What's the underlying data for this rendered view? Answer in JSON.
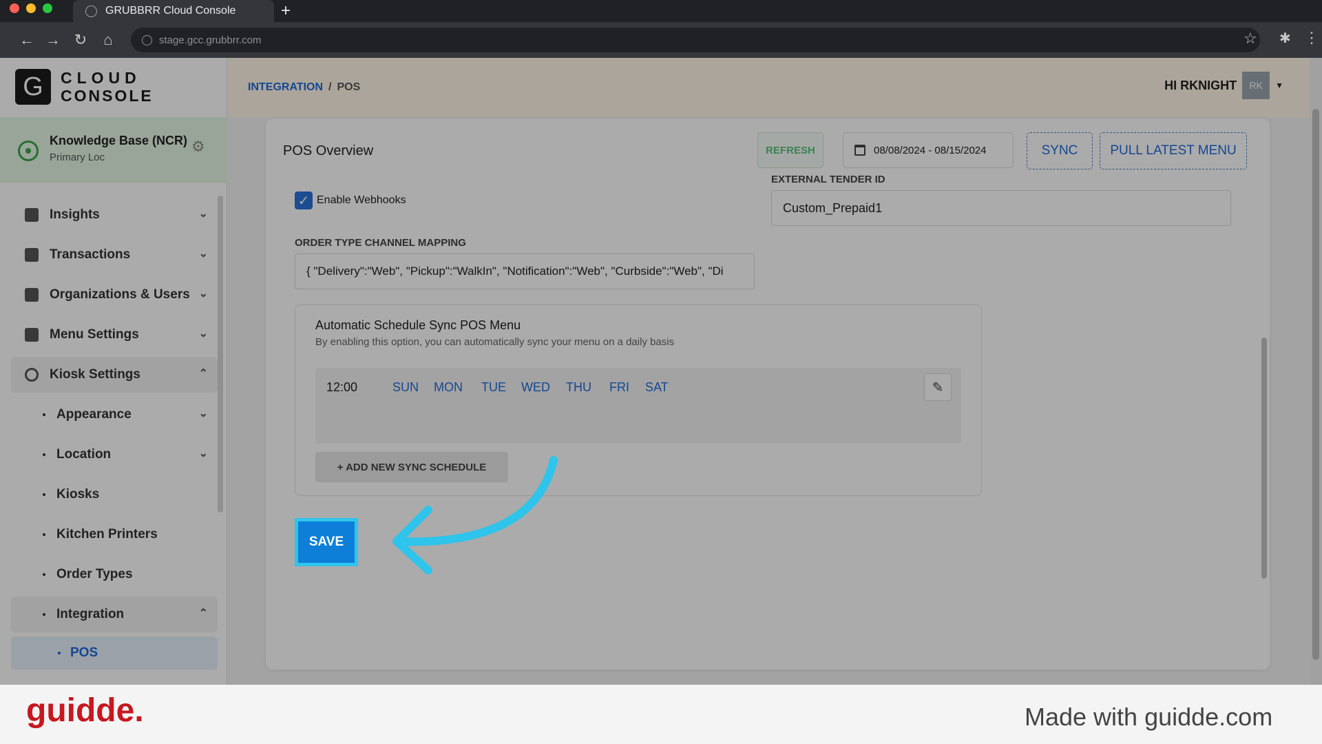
{
  "browser": {
    "tab_title": "GRUBBRR Cloud Console",
    "url": "stage.gcc.grubbrr.com"
  },
  "logo": {
    "mark": "G",
    "line1": "CLOUD",
    "line2": "CONSOLE"
  },
  "location": {
    "name": "Knowledge Base (NCR)",
    "sub": "Primary Loc"
  },
  "sidebar": {
    "items": [
      {
        "label": "Insights"
      },
      {
        "label": "Transactions"
      },
      {
        "label": "Organizations & Users"
      },
      {
        "label": "Menu Settings"
      },
      {
        "label": "Kiosk Settings"
      }
    ],
    "sub_items": [
      {
        "label": "Appearance"
      },
      {
        "label": "Location"
      },
      {
        "label": "Kiosks"
      },
      {
        "label": "Kitchen Printers"
      },
      {
        "label": "Order Types"
      },
      {
        "label": "Integration"
      }
    ],
    "active_leaf": "POS"
  },
  "breadcrumb": {
    "parent": "INTEGRATION",
    "sep": "/",
    "current": "POS"
  },
  "user": {
    "greeting": "HI RKNIGHT",
    "initials": "RK"
  },
  "card": {
    "title": "POS Overview",
    "refresh_label": "REFRESH",
    "date_range": "08/08/2024 - 08/15/2024",
    "sync_label": "SYNC",
    "pull_label": "PULL LATEST MENU",
    "webhook_label": "Enable Webhooks",
    "webhook_checked": true,
    "ext_tender_label": "EXTERNAL TENDER ID",
    "ext_tender_value": "Custom_Prepaid1",
    "otc_label": "ORDER TYPE CHANNEL MAPPING",
    "otc_value": "{ \"Delivery\":\"Web\", \"Pickup\":\"WalkIn\", \"Notification\":\"Web\", \"Curbside\":\"Web\", \"Di",
    "schedule": {
      "title": "Automatic Schedule Sync POS Menu",
      "subtitle": "By enabling this option, you can automatically sync your menu on a daily basis",
      "time": "12:00",
      "days": [
        "SUN",
        "MON",
        "TUE",
        "WED",
        "THU",
        "FRI",
        "SAT"
      ],
      "add_label": "+ ADD NEW SYNC SCHEDULE"
    },
    "save_label": "SAVE"
  },
  "footer": {
    "brand": "guidde.",
    "tagline": "Made with guidde.com"
  },
  "colors": {
    "accent": "#1f6ad8",
    "highlight": "#2ec4ec",
    "brand": "#c7171f"
  }
}
